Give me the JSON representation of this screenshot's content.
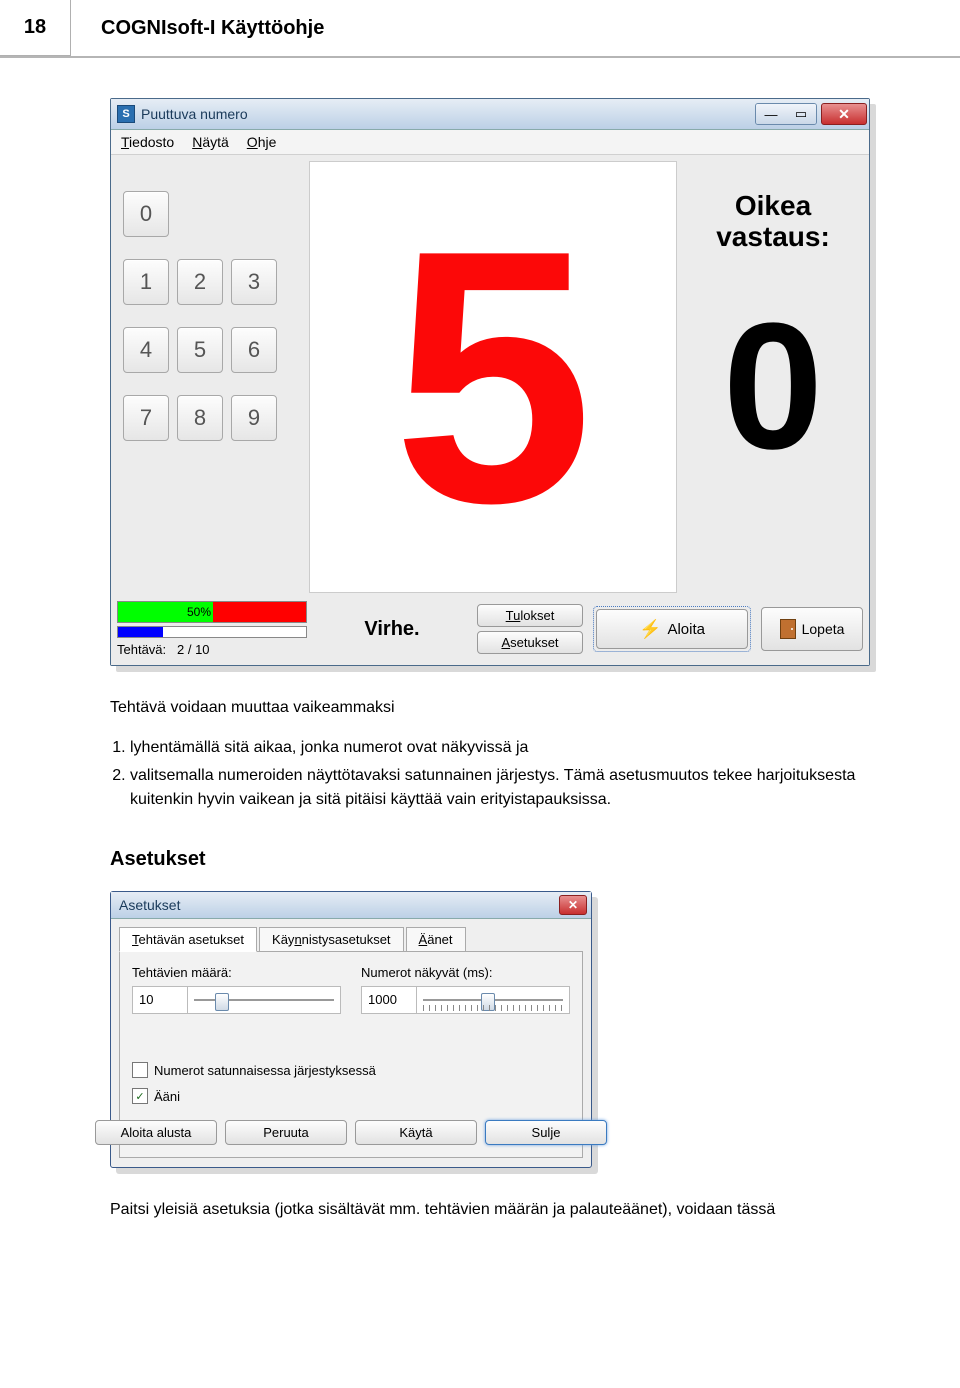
{
  "page_number": "18",
  "doc_title": "COGNIsoft-I Käyttöohje",
  "app_window": {
    "icon_letter": "S",
    "title": "Puuttuva numero",
    "menus": {
      "file": "Tiedosto",
      "view": "Näytä",
      "help": "Ohje"
    },
    "keypad": [
      "0",
      "1",
      "2",
      "3",
      "4",
      "5",
      "6",
      "7",
      "8",
      "9"
    ],
    "big_number": "5",
    "answer_label": "Oikea\nvastaus:",
    "answer_value": "0",
    "progress_pct": "50%",
    "task_label": "Tehtävä:",
    "task_count": "2 / 10",
    "status": "Virhe.",
    "btn_results": "Tulokset",
    "btn_settings": "Asetukset",
    "btn_start": "Aloita",
    "btn_quit": "Lopeta"
  },
  "body": {
    "intro": "Tehtävä voidaan muuttaa vaikeammaksi",
    "li1": "lyhentämällä sitä aikaa, jonka numerot ovat näkyvissä ja",
    "li2": "valitsemalla numeroiden näyttötavaksi satunnainen järjestys. Tämä asetusmuutos tekee harjoituksesta kuitenkin hyvin vaikean ja sitä pitäisi käyttää vain erityistapauksissa.",
    "section_heading": "Asetukset",
    "outro": "Paitsi yleisiä asetuksia (jotka sisältävät mm. tehtävien määrän ja palauteäänet), voidaan tässä"
  },
  "dialog": {
    "title": "Asetukset",
    "tabs": {
      "t1": "Tehtävän asetukset",
      "t2": "Käynnistysasetukset",
      "t3": "Äänet"
    },
    "field1_label": "Tehtävien määrä:",
    "field1_value": "10",
    "field2_label": "Numerot näkyvät (ms):",
    "field2_value": "1000",
    "chk1": "Numerot satunnaisessa järjestyksessä",
    "chk2": "Ääni",
    "btn_restart": "Aloita alusta",
    "btn_cancel": "Peruuta",
    "btn_apply": "Käytä",
    "btn_close": "Sulje"
  }
}
